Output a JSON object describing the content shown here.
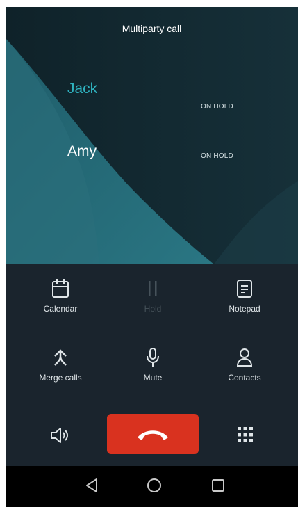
{
  "header": {
    "title": "Multiparty call"
  },
  "callers": [
    {
      "name": "Jack",
      "status": "ON HOLD"
    },
    {
      "name": "Amy",
      "status": "ON HOLD"
    }
  ],
  "actions": [
    {
      "label": "Calendar",
      "icon": "calendar-icon",
      "enabled": true
    },
    {
      "label": "Hold",
      "icon": "pause-icon",
      "enabled": false
    },
    {
      "label": "Notepad",
      "icon": "notepad-icon",
      "enabled": true
    },
    {
      "label": "Merge calls",
      "icon": "merge-icon",
      "enabled": true
    },
    {
      "label": "Mute",
      "icon": "microphone-icon",
      "enabled": true
    },
    {
      "label": "Contacts",
      "icon": "person-icon",
      "enabled": true
    }
  ],
  "bottom_controls": {
    "speaker_icon": "speaker-icon",
    "end_call_icon": "phone-hangup-icon",
    "dialpad_icon": "dialpad-icon",
    "end_call_color": "#d9321f"
  },
  "navigation": {
    "back_icon": "back-triangle-icon",
    "home_icon": "home-circle-icon",
    "recents_icon": "recents-square-icon"
  },
  "colors": {
    "accent": "#2fb3c0",
    "panel": "#1a242d",
    "background": "#13262d"
  }
}
